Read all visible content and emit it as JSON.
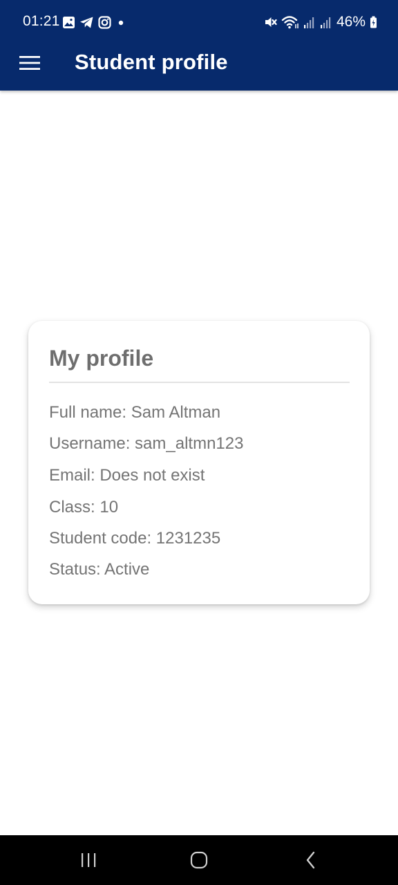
{
  "status_bar": {
    "time": "01:21",
    "battery": "46%",
    "left_icons": [
      "gallery-icon",
      "telegram-icon",
      "instagram-icon",
      "dot-icon"
    ],
    "right_icons": [
      "mute-icon",
      "wifi-icon",
      "signal-icon",
      "signal-icon",
      "battery-icon"
    ]
  },
  "app_bar": {
    "title": "Student profile",
    "menu_icon": "hamburger-menu-icon",
    "background_color": "#072a6c"
  },
  "profile": {
    "title": "My profile",
    "full_name": "Full name: Sam Altman",
    "username": "Username: sam_altmn123",
    "email": "Email: Does not exist",
    "class": "Class: 10",
    "student_code": "Student code: 1231235",
    "status": "Status: Active"
  },
  "nav_bar": {
    "icons": [
      "recents-icon",
      "home-icon",
      "back-icon"
    ]
  }
}
